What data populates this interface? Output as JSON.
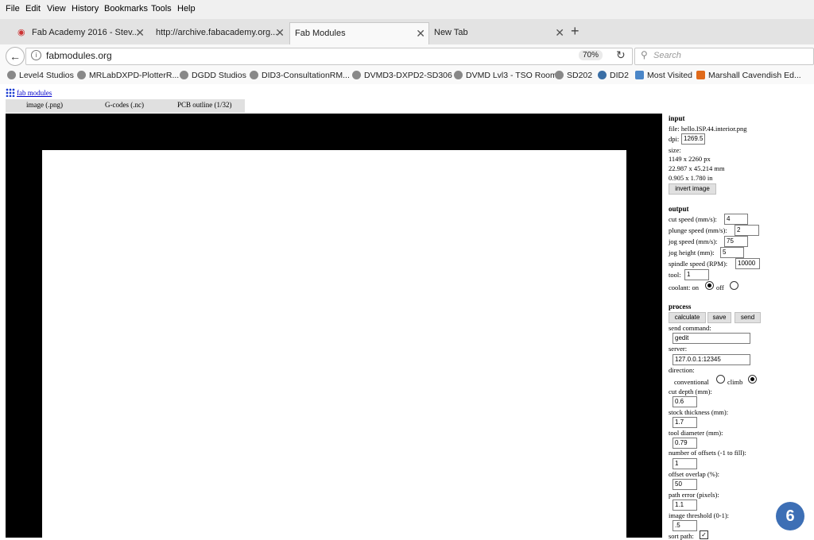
{
  "menu": [
    "File",
    "Edit",
    "View",
    "History",
    "Bookmarks",
    "Tools",
    "Help"
  ],
  "tabs": [
    {
      "title": "Fab Academy 2016 - Stev...",
      "active": false
    },
    {
      "title": "http://archive.fabacademy.org...",
      "active": false
    },
    {
      "title": "Fab Modules",
      "active": true
    },
    {
      "title": "New Tab",
      "active": false
    }
  ],
  "newtab_label": "+",
  "address": {
    "url": "fabmodules.org",
    "zoom": "70%"
  },
  "search": {
    "placeholder": "Search"
  },
  "bookmarks": [
    "Level4 Studios",
    "MRLabDXPD-PlotterR...",
    "DGDD Studios",
    "DID3-ConsultationRM...",
    "DVMD3-DXPD2-SD306",
    "DVMD Lvl3 - TSO Room",
    "SD202",
    "DID2",
    "Most Visited",
    "Marshall Cavendish Ed..."
  ],
  "fab": {
    "link": "fab modules",
    "mod_tabs": [
      "image (.png)",
      "G-codes (.nc)",
      "PCB outline (1/32)"
    ]
  },
  "input": {
    "heading": "input",
    "file": "file: hello.ISP.44.interior.png",
    "dpi_label": "dpi:",
    "dpi_value": "1269.5",
    "size_label": "size:",
    "size_px": "1149 x 2260 px",
    "size_mm": "22.987 x 45.214 mm",
    "size_in": "0.905 x 1.780 in",
    "invert_button": "invert image"
  },
  "output": {
    "heading": "output",
    "cut_speed_label": "cut speed (mm/s):",
    "cut_speed": "4",
    "plunge_speed_label": "plunge speed (mm/s):",
    "plunge_speed": "2",
    "jog_speed_label": "jog speed (mm/s):",
    "jog_speed": "75",
    "jog_height_label": "jog height (mm):",
    "jog_height": "5",
    "spindle_label": "spindle speed (RPM):",
    "spindle": "10000",
    "tool_label": "tool:",
    "tool": "1",
    "coolant_label": "coolant: on",
    "coolant_off_label": "off"
  },
  "process": {
    "heading": "process",
    "calculate": "calculate",
    "save": "save",
    "send": "send",
    "send_command_label": "send command:",
    "send_command": "gedit",
    "server_label": "server:",
    "server": "127.0.0.1:12345",
    "direction_label": "direction:",
    "conventional_label": "conventional",
    "climb_label": "climb",
    "cut_depth_label": "cut depth (mm):",
    "cut_depth": "0.6",
    "stock_label": "stock thickness (mm):",
    "stock": "1.7",
    "tool_diameter_label": "tool diameter (mm):",
    "tool_diameter": "0.79",
    "offsets_label": "number of offsets (-1 to fill):",
    "offsets": "1",
    "overlap_label": "offset overlap (%):",
    "overlap": "50",
    "path_error_label": "path error (pixels):",
    "path_error": "1.1",
    "threshold_label": "image threshold (0-1):",
    "threshold": ".5",
    "sort_label": "sort path:"
  },
  "badge": "6"
}
